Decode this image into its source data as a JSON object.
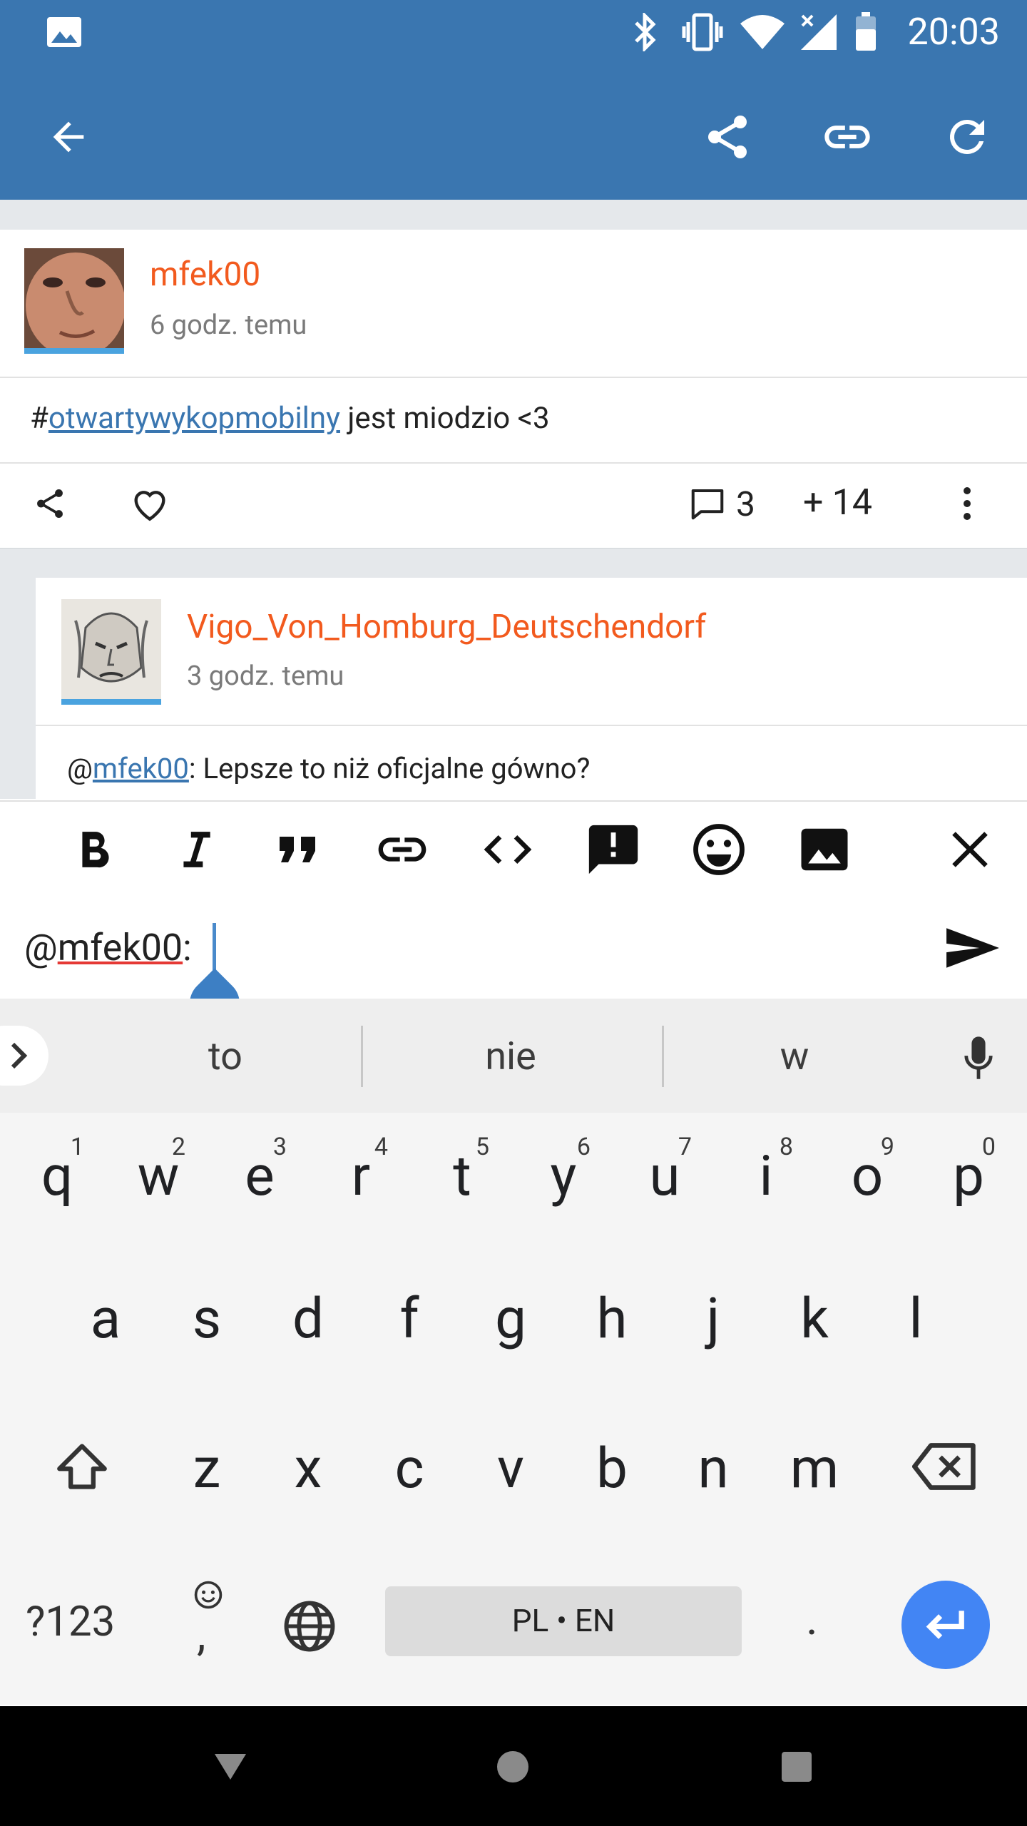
{
  "status_bar": {
    "time": "20:03",
    "icons": [
      "image-icon",
      "bluetooth-icon",
      "vibrate-icon",
      "wifi-icon",
      "signal-icon",
      "battery-icon"
    ]
  },
  "app_bar": {
    "icons": [
      "back-arrow-icon",
      "share-icon",
      "link-icon",
      "refresh-icon"
    ]
  },
  "post": {
    "author": "mfek00",
    "time": "6 godz. temu",
    "text_prefix": "#",
    "tag": "otwartywykopmobilny",
    "text_suffix": " jest miodzio <3",
    "comments_count": "3",
    "votes": "+ 14"
  },
  "comment": {
    "author": "Vigo_Von_Homburg_Deutschendorf",
    "time": "3 godz. temu",
    "mention_prefix": "@",
    "mention": "mfek00",
    "text": ": Lepsze to niż oficjalne gówno?"
  },
  "toolbar": {
    "icons": [
      "bold-icon",
      "italic-icon",
      "quote-icon",
      "link-icon",
      "code-icon",
      "spoiler-icon",
      "emoji-icon",
      "image-icon",
      "close-icon"
    ]
  },
  "composer": {
    "prefix": "@",
    "mention": "mfek00",
    "suffix": ":"
  },
  "keyboard": {
    "suggestions": [
      "to",
      "nie",
      "w"
    ],
    "row1": [
      {
        "k": "q",
        "h": "1"
      },
      {
        "k": "w",
        "h": "2"
      },
      {
        "k": "e",
        "h": "3"
      },
      {
        "k": "r",
        "h": "4"
      },
      {
        "k": "t",
        "h": "5"
      },
      {
        "k": "y",
        "h": "6"
      },
      {
        "k": "u",
        "h": "7"
      },
      {
        "k": "i",
        "h": "8"
      },
      {
        "k": "o",
        "h": "9"
      },
      {
        "k": "p",
        "h": "0"
      }
    ],
    "row2": [
      "a",
      "s",
      "d",
      "f",
      "g",
      "h",
      "j",
      "k",
      "l"
    ],
    "row3": [
      "z",
      "x",
      "c",
      "v",
      "b",
      "n",
      "m"
    ],
    "symbols_key": "?123",
    "comma_key": ",",
    "space_label": "PL • EN",
    "period_key": ".",
    "accent_color": "#4285f4"
  },
  "colors": {
    "app_bar": "#3a76b0",
    "author": "#f25a1e",
    "link": "#3a76b0"
  }
}
